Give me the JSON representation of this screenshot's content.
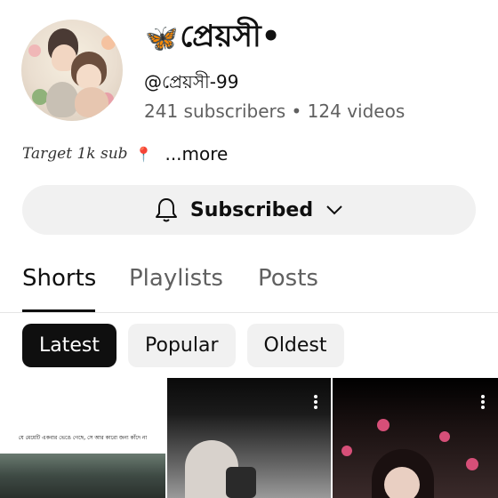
{
  "channel": {
    "name": "প্রেয়সী•",
    "handle": "@প্রেয়সী-99",
    "stats": "241 subscribers • 124 videos",
    "description": "Target 1k sub",
    "more_label": "...more"
  },
  "subscribe": {
    "label": "Subscribed"
  },
  "tabs": [
    "Shorts",
    "Playlists",
    "Posts"
  ],
  "active_tab": "Shorts",
  "chips": [
    "Latest",
    "Popular",
    "Oldest"
  ],
  "active_chip": "Latest",
  "shorts": [
    {
      "caption": "যে মেয়েটি একবার ভেঙে গেছে, সে আর কারো জন্য কাঁদে না"
    },
    {
      "caption": ""
    },
    {
      "caption": ""
    }
  ],
  "colors": {
    "accent": "#0f0f0f",
    "muted_text": "#606060",
    "chip_bg": "#f1f1f1",
    "pin": "#e11d2b",
    "butterfly": "#f08a00"
  },
  "icons": {
    "notification": "bell-icon",
    "dropdown": "chevron-down-icon",
    "overflow": "more-vert-icon",
    "pin": "pin-icon",
    "emblem": "butterfly-icon"
  }
}
